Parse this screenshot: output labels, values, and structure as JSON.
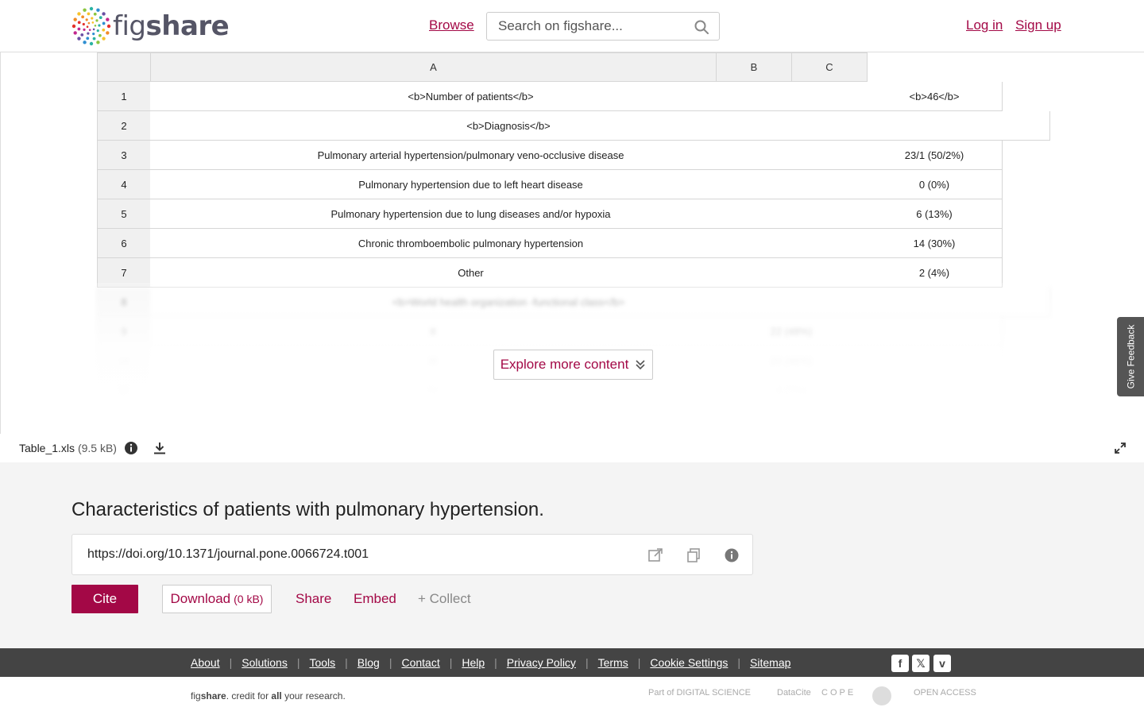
{
  "header": {
    "logo_text_light": "fig",
    "logo_text_bold": "share",
    "browse": "Browse",
    "search_placeholder": "Search on figshare...",
    "login": "Log in",
    "signup": "Sign up"
  },
  "sheet": {
    "columns": [
      "A",
      "B",
      "C"
    ],
    "rows": [
      {
        "num": "1",
        "label": "<b>Number of patients</b>",
        "value": "<b>46</b>"
      },
      {
        "num": "2",
        "label": "<b>Diagnosis</b>",
        "value": ""
      },
      {
        "num": "3",
        "label": "Pulmonary arterial hypertension/pulmonary veno-occlusive disease",
        "value": "23/1 (50/2%)"
      },
      {
        "num": "4",
        "label": "Pulmonary hypertension due to left heart disease",
        "value": "0 (0%)"
      },
      {
        "num": "5",
        "label": "Pulmonary hypertension due to lung diseases and/or hypoxia",
        "value": "6 (13%)"
      },
      {
        "num": "6",
        "label": "Chronic thromboembolic pulmonary hypertension",
        "value": "14 (30%)"
      },
      {
        "num": "7",
        "label": "Other",
        "value": "2 (4%)"
      },
      {
        "num": "8",
        "label": "<b>World health organization -functional class</b>",
        "value": ""
      },
      {
        "num": "9",
        "label": "II",
        "value": "22 (48%)"
      },
      {
        "num": "10",
        "label": "III",
        "value": "20 (46%)"
      },
      {
        "num": "11",
        "label": "IV",
        "value": "4 (7%)"
      }
    ],
    "explore": "Explore more content"
  },
  "feedback": "Give Feedback",
  "file": {
    "name": "Table_1.xls",
    "size": "(9.5 kB)"
  },
  "item": {
    "title": "Characteristics of patients with pulmonary hypertension.",
    "doi": "https://doi.org/10.1371/journal.pone.0066724.t001",
    "cite": "Cite",
    "download": "Download",
    "download_size": "(0 kB)",
    "share": "Share",
    "embed": "Embed",
    "collect": "+ Collect"
  },
  "footer": {
    "links": [
      "About",
      "Solutions",
      "Tools",
      "Blog",
      "Contact",
      "Help",
      "Privacy Policy",
      "Terms",
      "Cookie Settings",
      "Sitemap"
    ],
    "tagline_pre": "fig",
    "tagline_brand": "share",
    "tagline_mid": ". credit for ",
    "tagline_all": "all",
    "tagline_post": " your research.",
    "partners": [
      "Part of DIGITAL SCIENCE",
      "DataCite",
      "COPE",
      "OPEN ACCESS"
    ]
  }
}
